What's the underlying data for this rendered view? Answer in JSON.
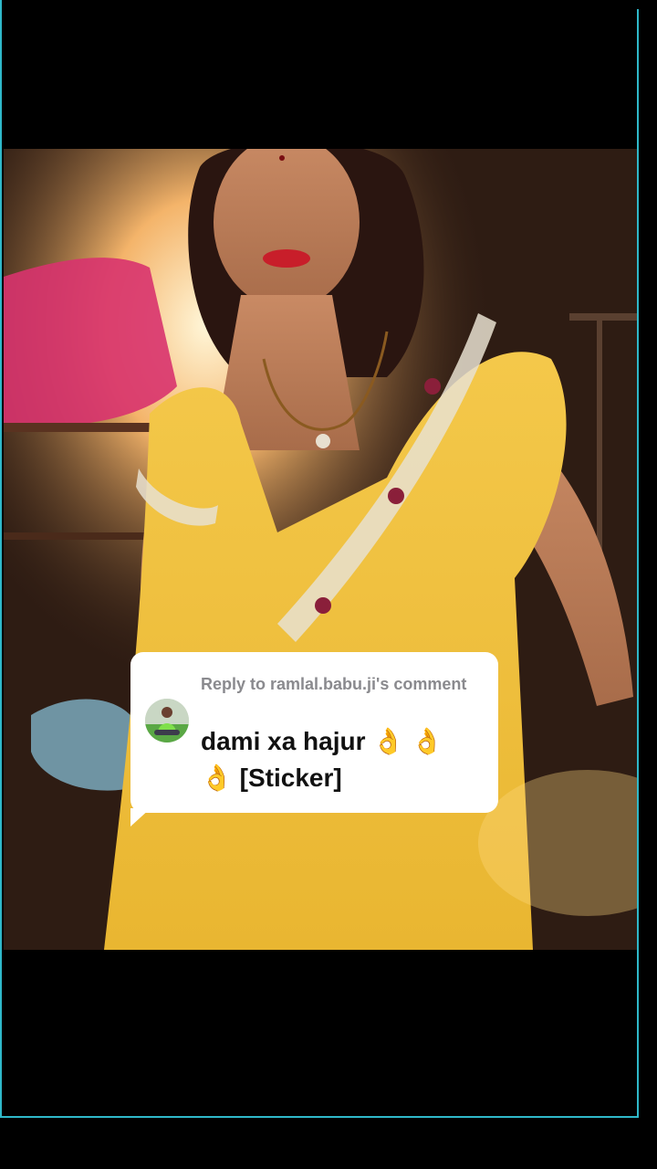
{
  "reply": {
    "header": "Reply to ramlal.babu.ji's comment",
    "text": "dami xa hajur 👌 👌 👌 [Sticker]"
  },
  "colors": {
    "background": "#000000",
    "frame_line": "#2fb8c9",
    "card_background": "#ffffff",
    "header_text": "#8a8a8e",
    "reply_text": "#111111"
  },
  "icons": {
    "avatar": "user-avatar-green-shirt"
  }
}
